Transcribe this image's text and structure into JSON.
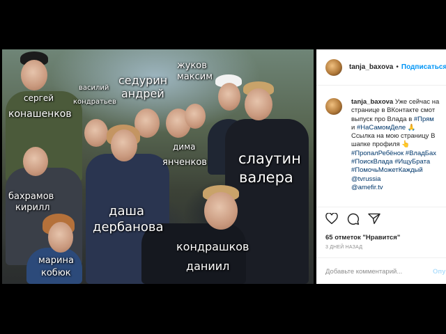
{
  "photo": {
    "labels": {
      "sergey": [
        "сергей",
        "конашенков"
      ],
      "vasily": [
        "василий",
        "кондратьев"
      ],
      "sedurin": [
        "седурин",
        "андрей"
      ],
      "zhukov": [
        "жуков",
        "максим"
      ],
      "dima": [
        "дима",
        "янченков"
      ],
      "slautin": [
        "слаутин",
        "валера"
      ],
      "bakhramov": [
        "бахрамов",
        "кирилл"
      ],
      "dasha": [
        "даша",
        "дербанова"
      ],
      "marina": [
        "марина",
        "кобюк"
      ],
      "kondrashkov": [
        "кондрашков",
        "даниил"
      ]
    }
  },
  "post": {
    "username": "tanja_baxova",
    "dot": "•",
    "follow_label": "Подписаться",
    "caption": {
      "username": "tanja_baxova",
      "lines": [
        "Уже сейчас на",
        "странице в ВКонтакте смот",
        "выпуск про Влада в ",
        "и ",
        "Ссылка на мою страницу В",
        "шапке профиля "
      ],
      "tags": {
        "pryam": "#Прям",
        "na_samom_dele": "#НаСамомДеле",
        "line7": "#ПропалРебёнок #ВладБах",
        "line8": "#ПоискВлада #ИщуБрата",
        "line9": "#ПомочьМожетКаждый",
        "line10": "@tvrussia",
        "line11": "@amefir.tv"
      },
      "emoji_pray": "🙏",
      "emoji_point": "👆"
    },
    "likes": "65 отметок \"Нравится\"",
    "time": "3 ДНЕЙ НАЗАД",
    "comment_placeholder": "Добавьте комментарий...",
    "post_label": "Опу",
    "icons": [
      "heart-icon",
      "comment-icon",
      "share-icon"
    ]
  }
}
